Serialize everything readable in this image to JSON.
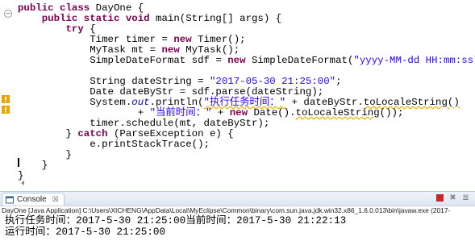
{
  "editor": {
    "lines": [
      [
        {
          "t": "public class",
          "c": "kw"
        },
        {
          "t": " DayOne {"
        }
      ],
      [
        {
          "t": "    "
        },
        {
          "t": "public static void",
          "c": "kw"
        },
        {
          "t": " main(String[] args) {"
        }
      ],
      [
        {
          "t": "        "
        },
        {
          "t": "try",
          "c": "kw"
        },
        {
          "t": " {"
        }
      ],
      [
        {
          "t": "            Timer timer = "
        },
        {
          "t": "new",
          "c": "kw"
        },
        {
          "t": " Timer();"
        }
      ],
      [
        {
          "t": "            MyTask mt = "
        },
        {
          "t": "new",
          "c": "kw"
        },
        {
          "t": " MyTask();"
        }
      ],
      [
        {
          "t": "            SimpleDateFormat sdf = "
        },
        {
          "t": "new",
          "c": "kw"
        },
        {
          "t": " SimpleDateFormat("
        },
        {
          "t": "\"yyyy-MM-dd HH:mm:ss\"",
          "c": "str"
        },
        {
          "t": ");"
        }
      ],
      [
        {
          "t": ""
        }
      ],
      [
        {
          "t": "            String dateString = "
        },
        {
          "t": "\"2017-05-30 21:25:00\"",
          "c": "str"
        },
        {
          "t": ";"
        }
      ],
      [
        {
          "t": "            Date dateByStr = sdf.parse(dateString);"
        }
      ],
      [
        {
          "t": "            System."
        },
        {
          "t": "out",
          "c": "static"
        },
        {
          "t": ".println("
        },
        {
          "t": "\"执行任务时间：\"",
          "c": "str warn"
        },
        {
          "t": " + dateByStr."
        },
        {
          "t": "toLocaleString",
          "c": "dep warn"
        },
        {
          "t": "()",
          "c": "warn"
        }
      ],
      [
        {
          "t": "                    + "
        },
        {
          "t": "\"当前时间：\"",
          "c": "str"
        },
        {
          "t": " + "
        },
        {
          "t": "new",
          "c": "kw"
        },
        {
          "t": " Date()."
        },
        {
          "t": "toLocaleString",
          "c": "dep warn"
        },
        {
          "t": "());"
        }
      ],
      [
        {
          "t": "            timer.schedule(mt, dateByStr);"
        }
      ],
      [
        {
          "t": "        } "
        },
        {
          "t": "catch",
          "c": "kw"
        },
        {
          "t": " (ParseException e) {"
        }
      ],
      [
        {
          "t": "            e.printStackTrace();"
        }
      ],
      [
        {
          "t": "        }"
        }
      ],
      [
        {
          "t": "    }"
        }
      ],
      [
        {
          "t": "}"
        }
      ]
    ],
    "line_height": 13
  },
  "console": {
    "tab_label": "Console",
    "header": "DayOne [Java Application] C:\\Users\\XICHENG\\AppData\\Local\\MyEclipse\\Common\\binary\\com.sun.java.jdk.win32.x86_1.6.0.013\\bin\\javaw.exe (2017-",
    "output": [
      "执行任务时间：2017-5-30 21:25:00当前时间：2017-5-30 21:22:13",
      "运行时间：2017-5-30 21:25:00"
    ]
  },
  "icons": {
    "warning_marker": "warning-icon",
    "fold": "collapse-icon",
    "console": "console-icon",
    "terminate": "terminate-icon",
    "remove": "remove-launch-icon",
    "scroll_lock": "scroll-lock-icon"
  },
  "colors": {
    "keyword": "#7f0055",
    "string": "#2a00ff",
    "static_field": "#0000c0",
    "warning": "#f0b500"
  }
}
